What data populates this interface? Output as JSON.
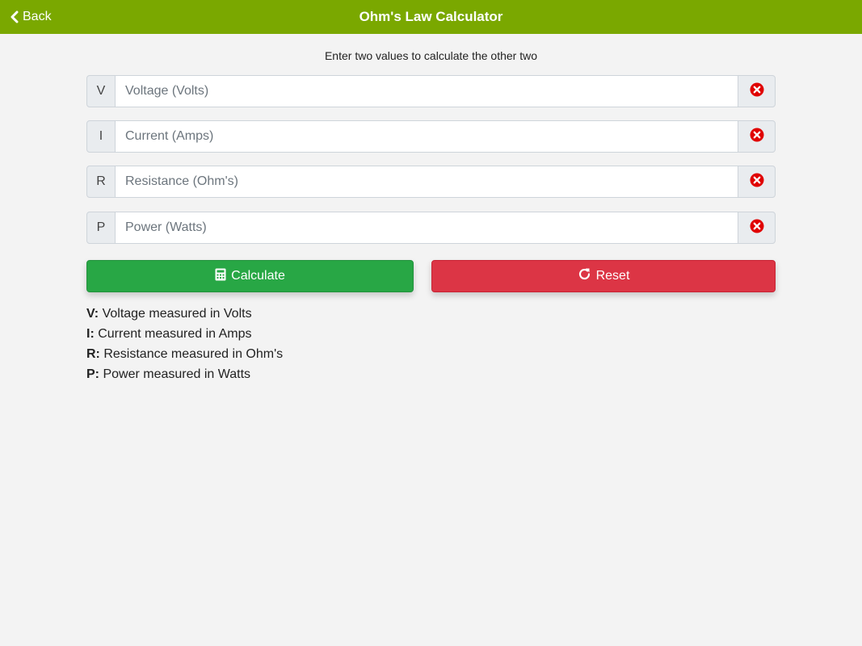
{
  "header": {
    "back_label": "Back",
    "title": "Ohm's Law Calculator"
  },
  "instructions": "Enter two values to calculate the other two",
  "fields": [
    {
      "prefix": "V",
      "placeholder": "Voltage (Volts)",
      "value": ""
    },
    {
      "prefix": "I",
      "placeholder": "Current (Amps)",
      "value": ""
    },
    {
      "prefix": "R",
      "placeholder": "Resistance (Ohm's)",
      "value": ""
    },
    {
      "prefix": "P",
      "placeholder": "Power (Watts)",
      "value": ""
    }
  ],
  "buttons": {
    "calculate_label": "Calculate",
    "reset_label": "Reset"
  },
  "legend": [
    {
      "key": "V:",
      "text": " Voltage measured in Volts"
    },
    {
      "key": "I:",
      "text": " Current measured in Amps"
    },
    {
      "key": "R:",
      "text": " Resistance measured in Ohm's"
    },
    {
      "key": "P:",
      "text": " Power measured in Watts"
    }
  ],
  "icons": {
    "back": "chevron-left-icon",
    "clear": "times-circle-icon",
    "calculate": "calculator-icon",
    "reset": "redo-icon"
  },
  "colors": {
    "header": "#7aa800",
    "calculate": "#28a745",
    "reset": "#dc3545",
    "clear_icon": "#e00000"
  }
}
